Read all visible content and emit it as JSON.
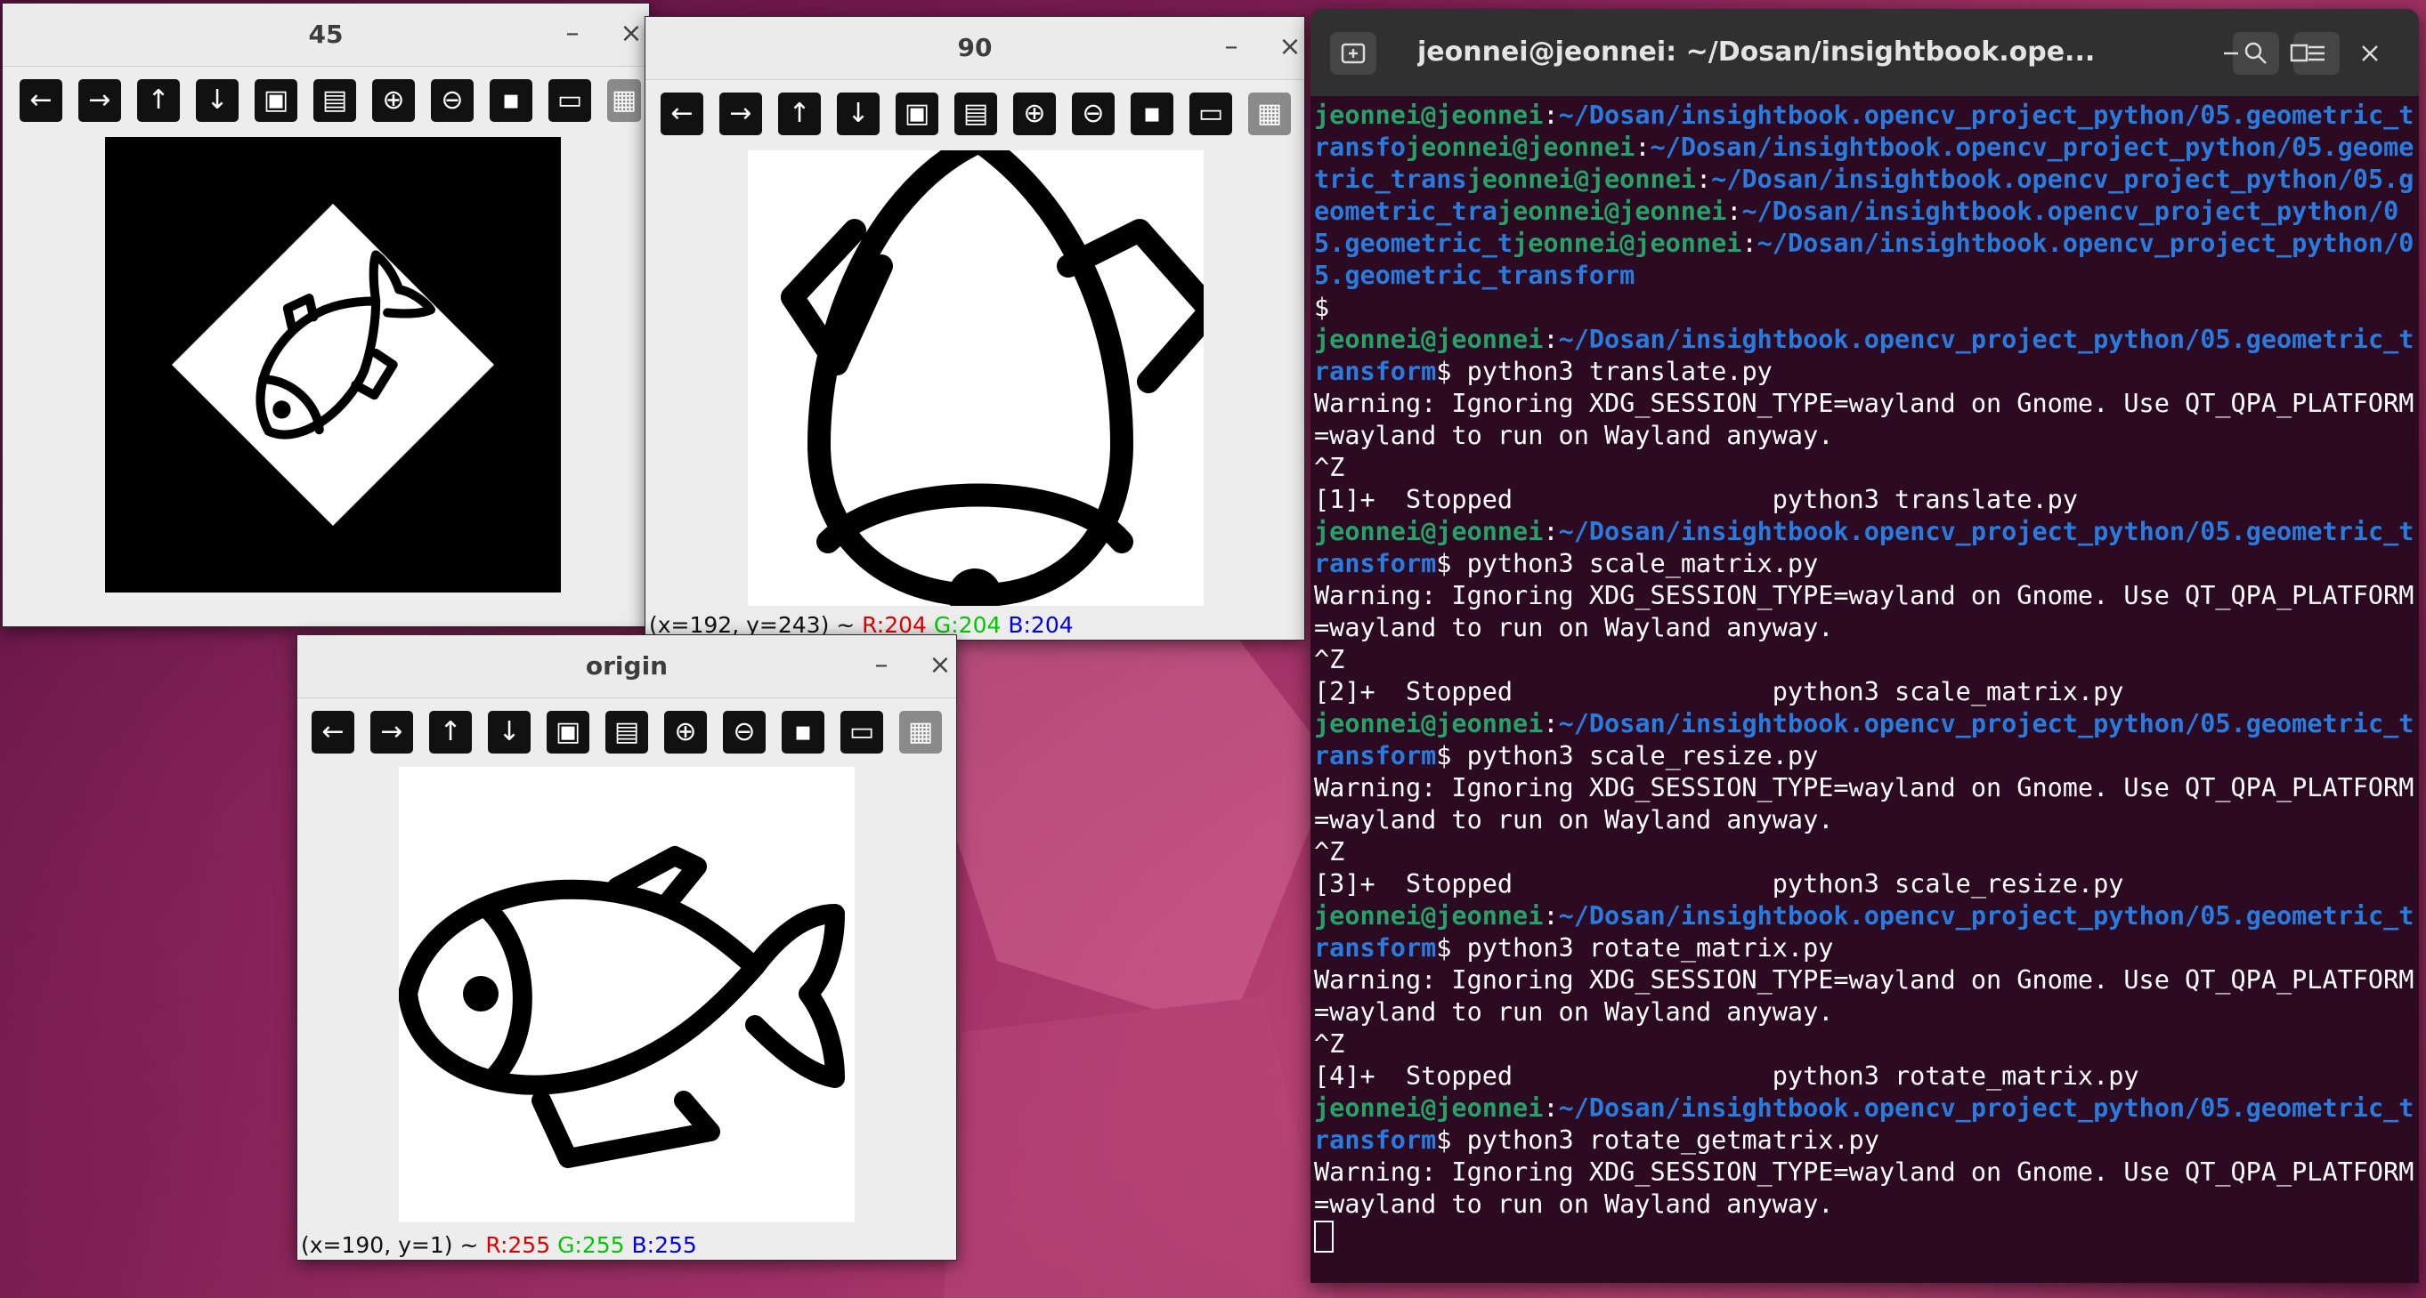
{
  "windows": {
    "w45": {
      "title": "45",
      "minimize_label": "–",
      "close_label": "×"
    },
    "w90": {
      "title": "90",
      "minimize_label": "–",
      "close_label": "×",
      "status": {
        "coords": "(x=192, y=243) ~",
        "r": "R:204",
        "g": "G:204",
        "b": "B:204"
      }
    },
    "origin": {
      "title": "origin",
      "minimize_label": "–",
      "close_label": "×",
      "status": {
        "coords": "(x=190, y=1) ~",
        "r": "R:255",
        "g": "G:255",
        "b": "B:255"
      }
    }
  },
  "toolbar_icons": [
    "arrow-left-icon",
    "arrow-right-icon",
    "arrow-up-icon",
    "arrow-down-icon",
    "image-icon",
    "image-settings-icon",
    "zoom-in-icon",
    "zoom-out-icon",
    "save-icon",
    "clipboard-icon",
    "properties-icon"
  ],
  "terminal": {
    "title": "jeonnei@jeonnei: ~/Dosan/insightbook.ope...",
    "lines": [
      [
        {
          "t": "jeonnei@jeonnei",
          "c": "u"
        },
        {
          "t": ":",
          "c": ""
        },
        {
          "t": "~/Dosan/insightbook.opencv_project_python/05.geometric_transfo",
          "c": "p"
        },
        {
          "t": "jeonnei@jeonnei",
          "c": "u"
        },
        {
          "t": ":",
          "c": ""
        },
        {
          "t": "~/Dosan/insightbook.opencv_project_python/05.geometric_trans",
          "c": "p"
        },
        {
          "t": "jeonnei@jeonnei",
          "c": "u"
        },
        {
          "t": ":",
          "c": ""
        },
        {
          "t": "~/Dosan/insightbook.opencv_project_python/05.geometric_tra",
          "c": "p"
        },
        {
          "t": "jeonnei@jeonnei",
          "c": "u"
        },
        {
          "t": ":",
          "c": ""
        },
        {
          "t": "~/Dosan/insightbook.opencv_project_python/05.geometric_t",
          "c": "p"
        },
        {
          "t": "jeonnei@jeonnei",
          "c": "u"
        },
        {
          "t": ":",
          "c": ""
        },
        {
          "t": "~/Dosan/insightbook.opencv_project_python/05.geometric_transform",
          "c": "p"
        }
      ],
      [
        {
          "t": "$",
          "c": ""
        }
      ],
      [
        {
          "t": "jeonnei@jeonnei",
          "c": "u"
        },
        {
          "t": ":",
          "c": ""
        },
        {
          "t": "~/Dosan/insightbook.opencv_project_python/05.geometric_transform",
          "c": "p"
        },
        {
          "t": "$ python3 translate.py",
          "c": ""
        }
      ],
      [
        {
          "t": "Warning: Ignoring XDG_SESSION_TYPE=wayland on Gnome. Use QT_QPA_PLATFORM=wayland to run on Wayland anyway.",
          "c": ""
        }
      ],
      [
        {
          "t": "^Z",
          "c": ""
        }
      ],
      [
        {
          "t": "[1]+  Stopped                 python3 translate.py",
          "c": ""
        }
      ],
      [
        {
          "t": "jeonnei@jeonnei",
          "c": "u"
        },
        {
          "t": ":",
          "c": ""
        },
        {
          "t": "~/Dosan/insightbook.opencv_project_python/05.geometric_transform",
          "c": "p"
        },
        {
          "t": "$ python3 scale_matrix.py",
          "c": ""
        }
      ],
      [
        {
          "t": "Warning: Ignoring XDG_SESSION_TYPE=wayland on Gnome. Use QT_QPA_PLATFORM=wayland to run on Wayland anyway.",
          "c": ""
        }
      ],
      [
        {
          "t": "^Z",
          "c": ""
        }
      ],
      [
        {
          "t": "[2]+  Stopped                 python3 scale_matrix.py",
          "c": ""
        }
      ],
      [
        {
          "t": "jeonnei@jeonnei",
          "c": "u"
        },
        {
          "t": ":",
          "c": ""
        },
        {
          "t": "~/Dosan/insightbook.opencv_project_python/05.geometric_transform",
          "c": "p"
        },
        {
          "t": "$ python3 scale_resize.py",
          "c": ""
        }
      ],
      [
        {
          "t": "Warning: Ignoring XDG_SESSION_TYPE=wayland on Gnome. Use QT_QPA_PLATFORM=wayland to run on Wayland anyway.",
          "c": ""
        }
      ],
      [
        {
          "t": "^Z",
          "c": ""
        }
      ],
      [
        {
          "t": "[3]+  Stopped                 python3 scale_resize.py",
          "c": ""
        }
      ],
      [
        {
          "t": "jeonnei@jeonnei",
          "c": "u"
        },
        {
          "t": ":",
          "c": ""
        },
        {
          "t": "~/Dosan/insightbook.opencv_project_python/05.geometric_transform",
          "c": "p"
        },
        {
          "t": "$ python3 rotate_matrix.py",
          "c": ""
        }
      ],
      [
        {
          "t": "Warning: Ignoring XDG_SESSION_TYPE=wayland on Gnome. Use QT_QPA_PLATFORM=wayland to run on Wayland anyway.",
          "c": ""
        }
      ],
      [
        {
          "t": "^Z",
          "c": ""
        }
      ],
      [
        {
          "t": "[4]+  Stopped                 python3 rotate_matrix.py",
          "c": ""
        }
      ],
      [
        {
          "t": "jeonnei@jeonnei",
          "c": "u"
        },
        {
          "t": ":",
          "c": ""
        },
        {
          "t": "~/Dosan/insightbook.opencv_project_python/05.geometric_transform",
          "c": "p"
        },
        {
          "t": "$ python3 rotate_getmatrix.py",
          "c": ""
        }
      ],
      [
        {
          "t": "Warning: Ignoring XDG_SESSION_TYPE=wayland on Gnome. Use QT_QPA_PLATFORM=wayland to run on Wayland anyway.",
          "c": ""
        }
      ]
    ]
  }
}
